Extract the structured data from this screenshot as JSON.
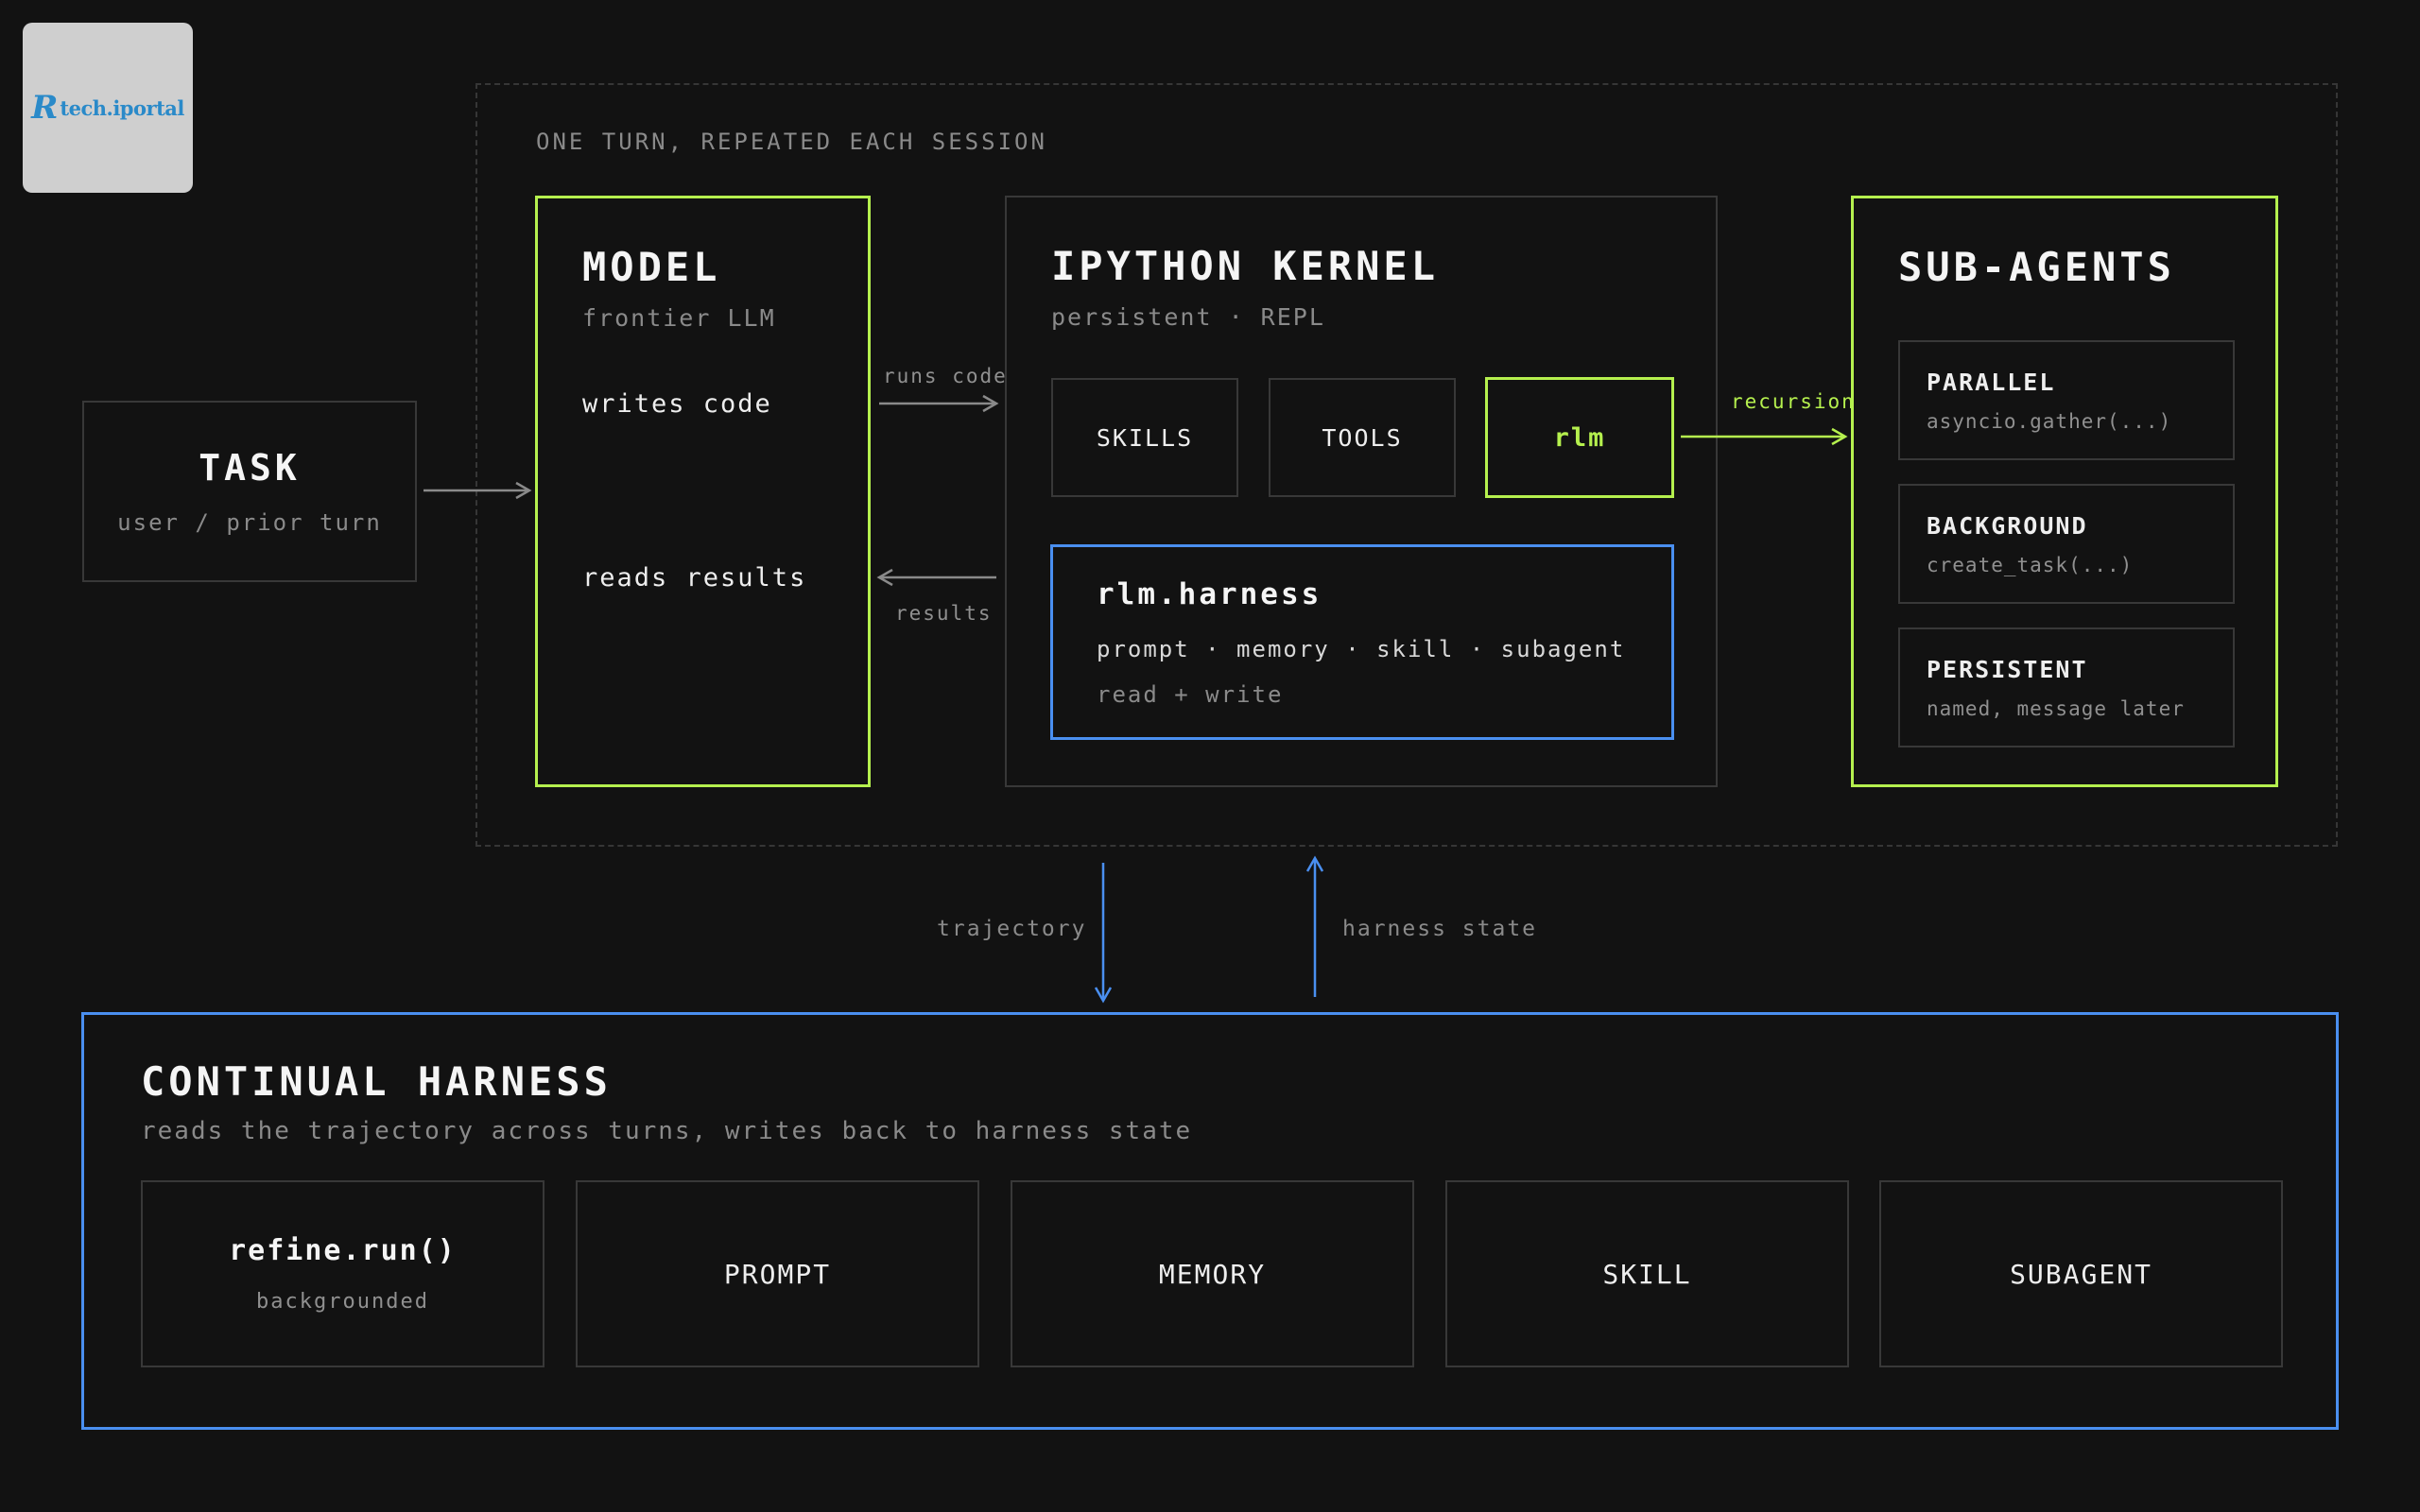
{
  "logo": {
    "text": "tech.iportal",
    "mark": "R"
  },
  "outer_loop": {
    "label": "ONE TURN, REPEATED EACH SESSION"
  },
  "task": {
    "title": "TASK",
    "subtitle": "user / prior turn"
  },
  "model": {
    "title": "MODEL",
    "subtitle": "frontier LLM",
    "writes": "writes code",
    "reads": "reads results"
  },
  "edges": {
    "runs_code": "runs code",
    "results": "results",
    "recursion": "recursion",
    "trajectory": "trajectory",
    "harness_state": "harness state"
  },
  "kernel": {
    "title": "IPYTHON KERNEL",
    "subtitle": "persistent · REPL",
    "chips": [
      "SKILLS",
      "TOOLS",
      "rlm"
    ],
    "harness": {
      "title": "rlm.harness",
      "items": "prompt · memory · skill · subagent",
      "mode": "read + write"
    }
  },
  "subagents": {
    "title": "SUB-AGENTS",
    "items": [
      {
        "title": "PARALLEL",
        "detail": "asyncio.gather(...)"
      },
      {
        "title": "BACKGROUND",
        "detail": "create_task(...)"
      },
      {
        "title": "PERSISTENT",
        "detail": "named, message later"
      }
    ]
  },
  "continual": {
    "title": "CONTINUAL HARNESS",
    "subtitle": "reads the trajectory across turns, writes back to harness state",
    "refine": {
      "title": "refine.run()",
      "detail": "backgrounded"
    },
    "cards": [
      "PROMPT",
      "MEMORY",
      "SKILL",
      "SUBAGENT"
    ]
  },
  "colors": {
    "background": "#121212",
    "accent_green": "#b5f04e",
    "accent_blue": "#4a8ff0",
    "border_gray": "#383838",
    "muted_text": "#8a8a8a"
  }
}
